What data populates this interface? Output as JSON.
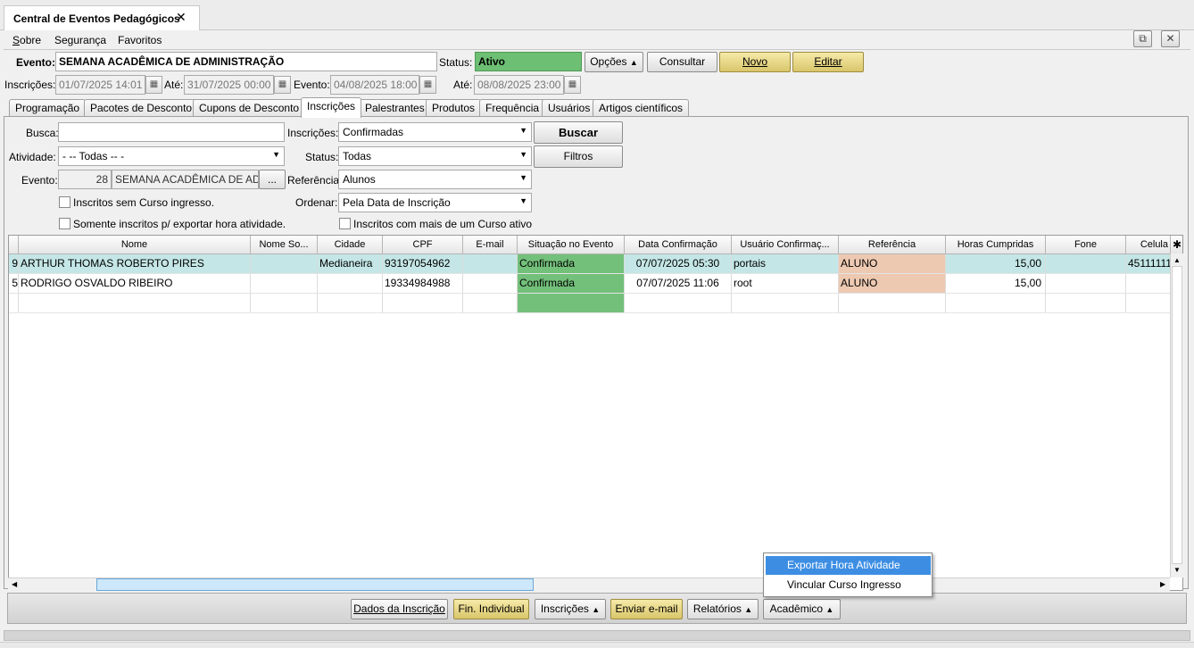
{
  "window": {
    "tab_title": "Central de Eventos Pedagógicos",
    "close_glyph": "✕"
  },
  "menu": {
    "items": [
      "Sobre",
      "Segurança",
      "Favoritos"
    ]
  },
  "window_buttons": {
    "popout_glyph": "⧉",
    "close_glyph": "✕"
  },
  "header": {
    "evento_label": "Evento:",
    "evento_value": "SEMANA ACADÊMICA DE ADMINISTRAÇÃO",
    "status_label": "Status:",
    "status_value": "Ativo",
    "opcoes_label": "Opções",
    "consultar_label": "Consultar",
    "novo_label": "Novo",
    "editar_label": "Editar",
    "inscricoes_label": "Inscrições:",
    "inscricoes_from": "01/07/2025 14:01",
    "ate_label": "Até:",
    "inscricoes_to": "31/07/2025 00:00",
    "evento_date_label": "Evento:",
    "evento_from": "04/08/2025 18:00",
    "evento_ate_label": "Até:",
    "evento_to": "08/08/2025 23:00"
  },
  "tabs": [
    "Programação",
    "Pacotes de Desconto",
    "Cupons de Desconto",
    "Inscrições",
    "Palestrantes",
    "Produtos",
    "Frequência",
    "Usuários",
    "Artigos científicos"
  ],
  "active_tab": "Inscrições",
  "filters": {
    "busca_label": "Busca:",
    "busca_value": "",
    "inscricoes_label": "Inscrições:",
    "inscricoes_value": "Confirmadas",
    "buscar_label": "Buscar",
    "atividade_label": "Atividade:",
    "atividade_value": "- -- Todas -- -",
    "status_label": "Status:",
    "status_value": "Todas",
    "filtros_label": "Filtros",
    "evento_label": "Evento:",
    "evento_id": "28",
    "evento_name": "SEMANA ACADÊMICA DE ADMINISTRAÇÃO",
    "ellipsis": "...",
    "referencia_label": "Referência",
    "referencia_value": "Alunos",
    "ordenar_label": "Ordenar:",
    "ordenar_value": "Pela Data de Inscrição",
    "chk_sem_curso": "Inscritos sem Curso ingresso.",
    "chk_exportar": "Somente inscritos p/ exportar hora atividade.",
    "chk_mais_curso": "Inscritos com mais de um Curso ativo"
  },
  "grid": {
    "columns": [
      "Nome",
      "Nome So...",
      "Cidade",
      "CPF",
      "E-mail",
      "Situação no Evento",
      "Data Confirmação",
      "Usuário Confirmaç...",
      "Referência",
      "Horas Cumpridas",
      "Fone",
      "Celula"
    ],
    "gear_glyph": "✱",
    "rows": [
      {
        "id_fragment": "9",
        "nome": "ARTHUR THOMAS ROBERTO PIRES",
        "nome_social": "",
        "cidade": "Medianeira",
        "cpf": "93197054962",
        "email": "",
        "situacao": "Confirmada",
        "data_confirmacao": "07/07/2025 05:30",
        "usuario": "portais",
        "referencia": "ALUNO",
        "horas": "15,00",
        "fone": "",
        "celular": "45111111"
      },
      {
        "id_fragment": "5",
        "nome": "RODRIGO OSVALDO RIBEIRO",
        "nome_social": "",
        "cidade": "",
        "cpf": "19334984988",
        "email": "",
        "situacao": "Confirmada",
        "data_confirmacao": "07/07/2025 11:06",
        "usuario": "root",
        "referencia": "ALUNO",
        "horas": "15,00",
        "fone": "",
        "celular": ""
      }
    ]
  },
  "footer": {
    "dados_label": "Dados da Inscrição",
    "fin_label": "Fin. Individual",
    "inscricoes_label": "Inscrições",
    "email_label": "Enviar e-mail",
    "relatorios_label": "Relatórios",
    "academico_label": "Acadêmico"
  },
  "context_menu": {
    "items": [
      "Exportar Hora Atividade",
      "Vincular Curso Ingresso"
    ],
    "highlighted": "Exportar Hora Atividade"
  },
  "colors": {
    "status_active": "#6dbf73",
    "situacao": "#73c07a",
    "referencia": "#edc9b1",
    "selected_row": "#c4e6e6",
    "yellow_button": "#e8d78a",
    "menu_highlight": "#3d8ee3"
  }
}
